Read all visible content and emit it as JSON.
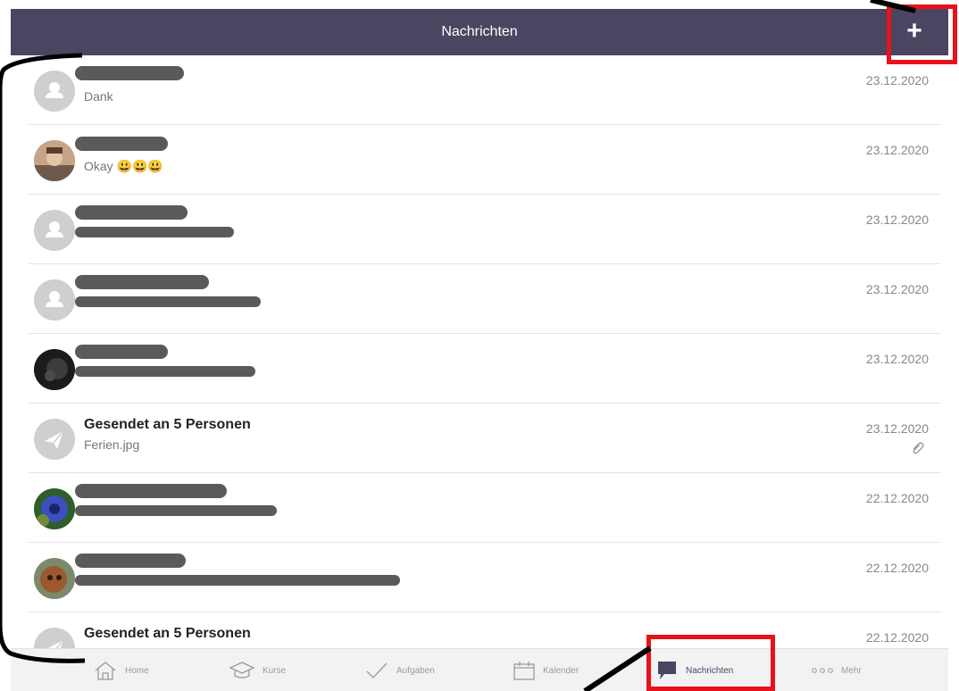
{
  "header": {
    "title": "Nachrichten",
    "add_label": "+"
  },
  "messages": [
    {
      "name": "",
      "preview": "Dank",
      "date": "23.12.2020",
      "avatar": "placeholder-person",
      "redacted": true
    },
    {
      "name": "",
      "preview": "Okay 😃😃😃",
      "date": "23.12.2020",
      "avatar": "photo",
      "redacted": true
    },
    {
      "name": "",
      "preview": "",
      "date": "23.12.2020",
      "avatar": "placeholder-person",
      "redacted": true
    },
    {
      "name": "",
      "preview": "",
      "date": "23.12.2020",
      "avatar": "placeholder-person",
      "redacted": true
    },
    {
      "name": "",
      "preview": "",
      "date": "23.12.2020",
      "avatar": "photo-dark",
      "redacted": true
    },
    {
      "name": "Gesendet an 5 Personen",
      "preview": "Ferien.jpg",
      "date": "23.12.2020",
      "avatar": "paper-plane",
      "attachment": true
    },
    {
      "name": "",
      "preview": "",
      "date": "22.12.2020",
      "avatar": "photo-flower",
      "redacted": true
    },
    {
      "name": "",
      "preview": "",
      "date": "22.12.2020",
      "avatar": "photo-dog",
      "redacted": true
    },
    {
      "name": "Gesendet an 5 Personen",
      "preview": "",
      "date": "22.12.2020",
      "avatar": "paper-plane"
    }
  ],
  "tabs": [
    {
      "label": "Home",
      "icon": "home-icon"
    },
    {
      "label": "Kurse",
      "icon": "graduation-cap-icon"
    },
    {
      "label": "Aufgaben",
      "icon": "checkmark-icon"
    },
    {
      "label": "Kalender",
      "icon": "calendar-icon"
    },
    {
      "label": "Nachrichten",
      "icon": "chat-bubble-icon",
      "active": true
    },
    {
      "label": "Mehr",
      "icon": "more-dots-icon"
    }
  ],
  "colors": {
    "header_bg": "#4a4560",
    "highlight": "#e8121a",
    "tab_active": "#4a4560",
    "tab_inactive": "#9a9a9a"
  }
}
